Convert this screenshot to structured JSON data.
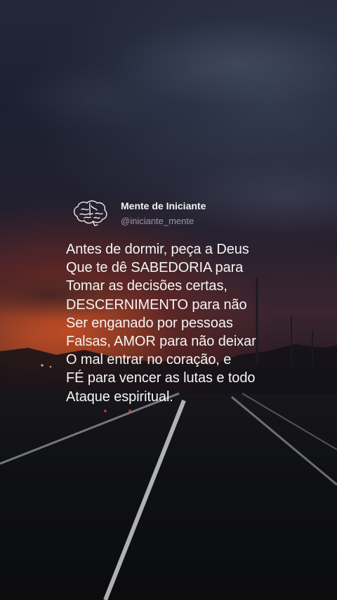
{
  "post": {
    "display_name": "Mente de Iniciante",
    "handle": "@iniciante_mente",
    "avatar_icon": "brain-icon",
    "quote_lines": [
      "Antes de dormir, peça a Deus",
      "Que te dê SABEDORIA para",
      "Tomar as decisões certas,",
      "DESCERNIMENTO para não",
      "Ser enganado por pessoas",
      "Falsas, AMOR para não deixar",
      "O mal entrar no coração, e",
      "FÉ para vencer as lutas e todo",
      "Ataque espiritual."
    ]
  },
  "colors": {
    "text": "#f4f4f4",
    "handle": "#9a9ca6",
    "sky_top": "#232838",
    "sunset": "#c44a22"
  }
}
